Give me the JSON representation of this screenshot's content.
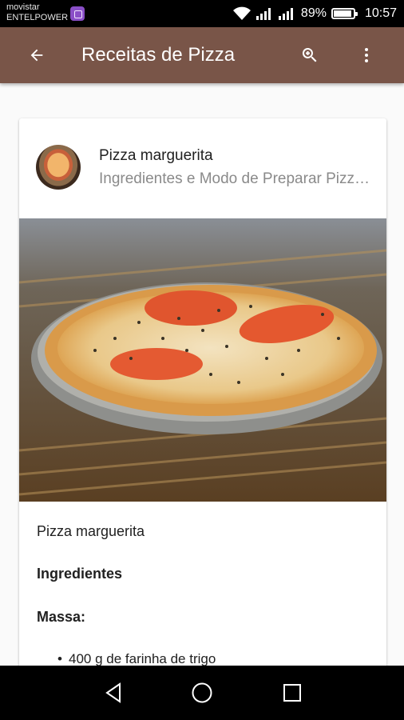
{
  "status_bar": {
    "carrier_line1": "movistar",
    "carrier_line2": "ENTELPOWER",
    "battery": "89%",
    "time": "10:57"
  },
  "app_bar": {
    "title": "Receitas de Pizza",
    "color": "#795548",
    "back_icon": "arrow-back-icon",
    "search_icon": "search-icon",
    "menu_icon": "more-vert-icon"
  },
  "card": {
    "title": "Pizza marguerita",
    "subtitle": "Ingredientes e Modo de Preparar Pizza marguerita",
    "recipe_name": "Pizza marguerita",
    "ingredients_heading": "Ingredientes",
    "dough_heading": "Massa:",
    "ingredients": [
      "400 g de farinha de trigo"
    ]
  },
  "nav_bar": {
    "back_icon": "nav-back-icon",
    "home_icon": "nav-home-icon",
    "recents_icon": "nav-recents-icon"
  }
}
